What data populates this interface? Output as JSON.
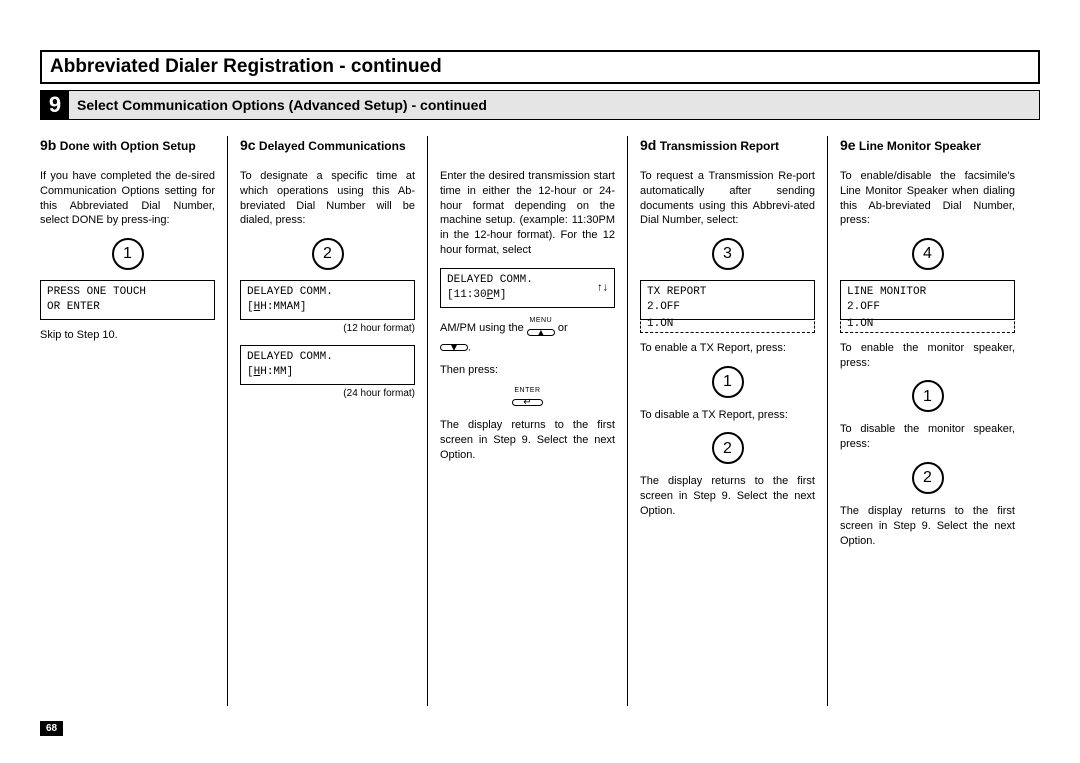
{
  "page": {
    "title": "Abbreviated Dialer Registration - continued",
    "section_number": "9",
    "section_title": "Select Communication Options (Advanced Setup) - continued",
    "page_number": "68"
  },
  "col_9b": {
    "num": "9b",
    "title": "Done with Option Setup",
    "body": "If you have completed the de-sired Communication Options setting for this Abbreviated Dial Number, select DONE by press-ing:",
    "key1": "1",
    "lcd1_l1": "PRESS ONE TOUCH",
    "lcd1_l2": "OR ENTER",
    "note": "Skip to Step 10."
  },
  "col_9c": {
    "num": "9c",
    "title": "Delayed Communications",
    "body": "To designate a specific time at which operations using this Ab-breviated Dial Number will be dialed, press:",
    "key1": "2",
    "lcd1_l1": "DELAYED COMM.",
    "lcd1_l2": "[HH:MMAM]",
    "lcd1_note": "(12 hour format)",
    "lcd2_l1": "DELAYED COMM.",
    "lcd2_l2": "[HH:MM]",
    "lcd2_note": "(24 hour format)"
  },
  "col_9c2": {
    "body": "Enter the desired transmission start time in either the 12-hour or 24-hour format depending on the machine setup. (example: 11:30PM in the 12-hour format). For the 12 hour format, select",
    "lcd1_l1": "DELAYED COMM.",
    "lcd1_l2": "[11:30PM]",
    "arrow": "↑↓",
    "ampm_pre": "AM/PM using the ",
    "ampm_mid": " or ",
    "ampm_post": ".",
    "menu_label": "MENU",
    "then": "Then press:",
    "enter_label": "ENTER",
    "tail": "The display returns to the first screen in Step 9. Select the next Option."
  },
  "col_9d": {
    "num": "9d",
    "title": "Transmission Report",
    "body": "To request a Transmission Re-port automatically after sending documents using this Abbrevi-ated Dial Number, select:",
    "key1": "3",
    "lcd_l1": "TX REPORT",
    "lcd_l2": "2.OFF",
    "lcd_dash": "1.ON",
    "enable": "To enable a TX Report, press:",
    "key_enable": "1",
    "disable": "To disable a TX Report, press:",
    "key_disable": "2",
    "tail": "The display returns to the first screen in Step 9. Select the next Option."
  },
  "col_9e": {
    "num": "9e",
    "title": "Line Monitor Speaker",
    "body": "To enable/disable the facsimile's Line Monitor Speaker when dialing this Ab-breviated Dial Number, press:",
    "key1": "4",
    "lcd_l1": "LINE MONITOR",
    "lcd_l2": "2.OFF",
    "lcd_dash": "1.ON",
    "enable": "To enable the monitor speaker, press:",
    "key_enable": "1",
    "disable": "To disable the monitor speaker, press:",
    "key_disable": "2",
    "tail": "The display returns to the first screen in Step 9. Select the next Option."
  }
}
